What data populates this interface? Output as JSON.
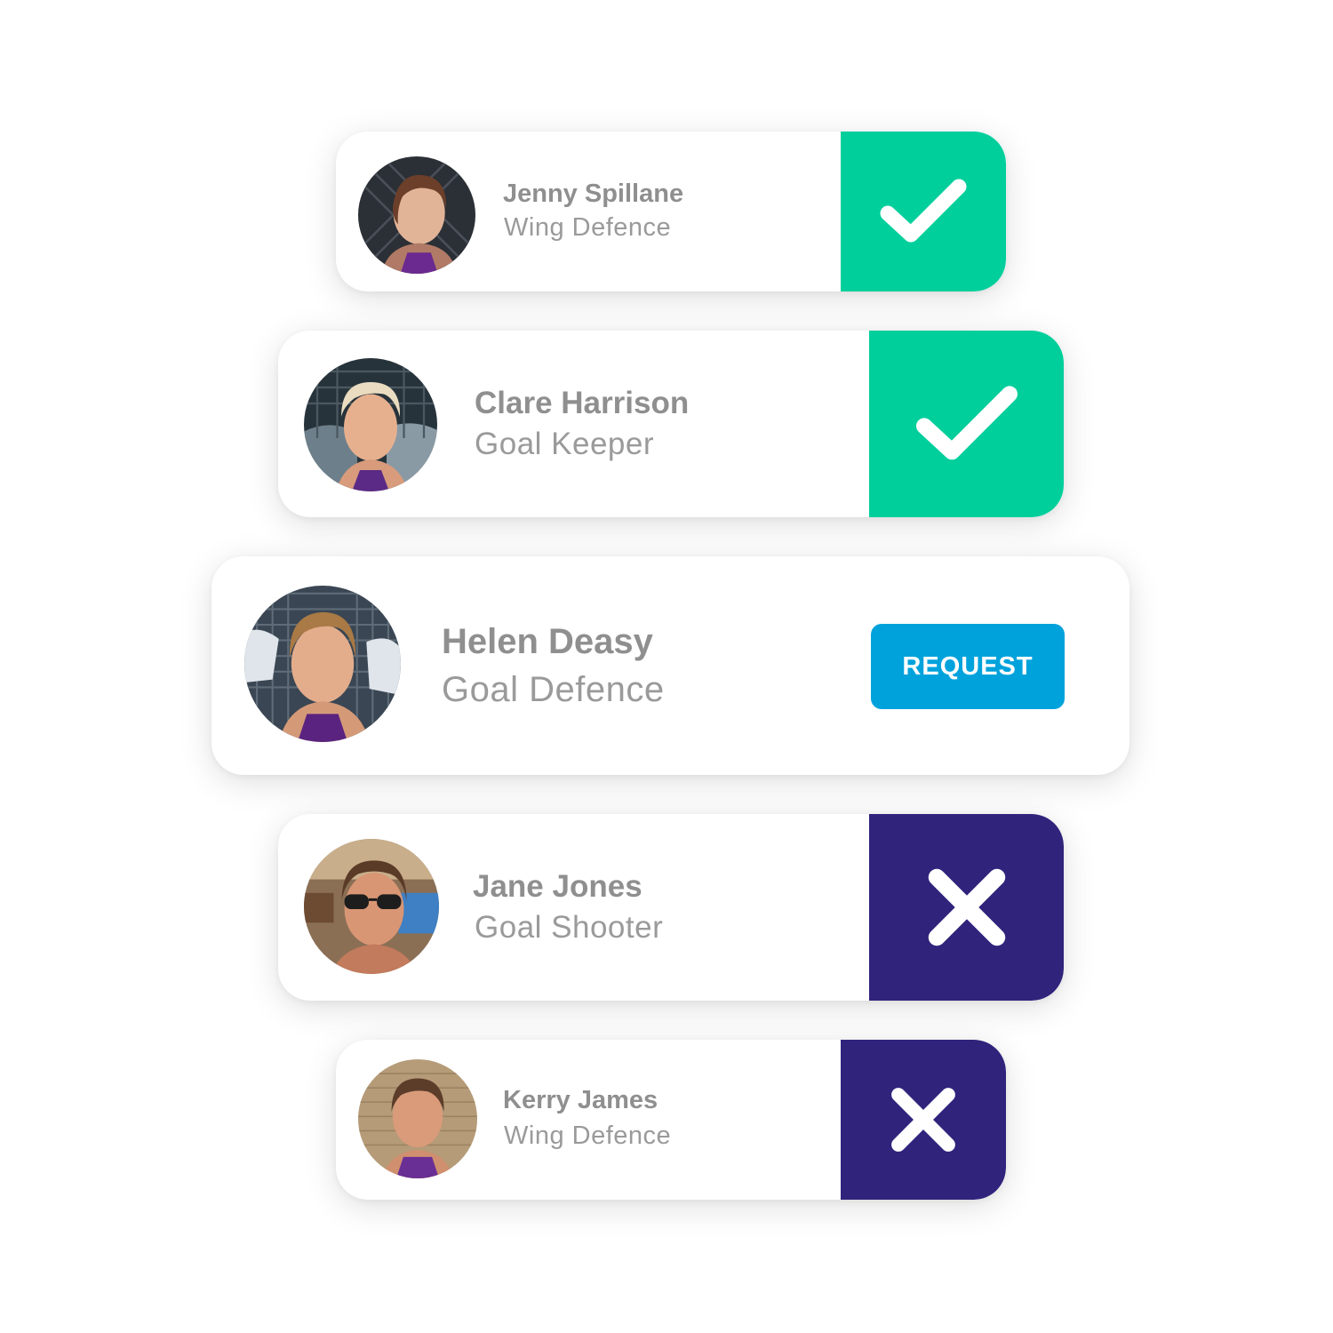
{
  "colors": {
    "accepted": "#00cf9c",
    "declined": "#30237c",
    "request": "#00a2dc",
    "name_text": "#8f8f8f",
    "role_text": "#9a9a9a"
  },
  "players": [
    {
      "name": "Jenny Spillane",
      "position": "Wing Defence",
      "status": "accepted",
      "status_icon": "check-icon"
    },
    {
      "name": "Clare Harrison",
      "position": "Goal Keeper",
      "status": "accepted",
      "status_icon": "check-icon"
    },
    {
      "name": "Helen Deasy",
      "position": "Goal Defence",
      "status": "pending",
      "action_label": "REQUEST"
    },
    {
      "name": "Jane Jones",
      "position": "Goal Shooter",
      "status": "declined",
      "status_icon": "close-icon"
    },
    {
      "name": "Kerry James",
      "position": "Wing Defence",
      "status": "declined",
      "status_icon": "close-icon"
    }
  ]
}
